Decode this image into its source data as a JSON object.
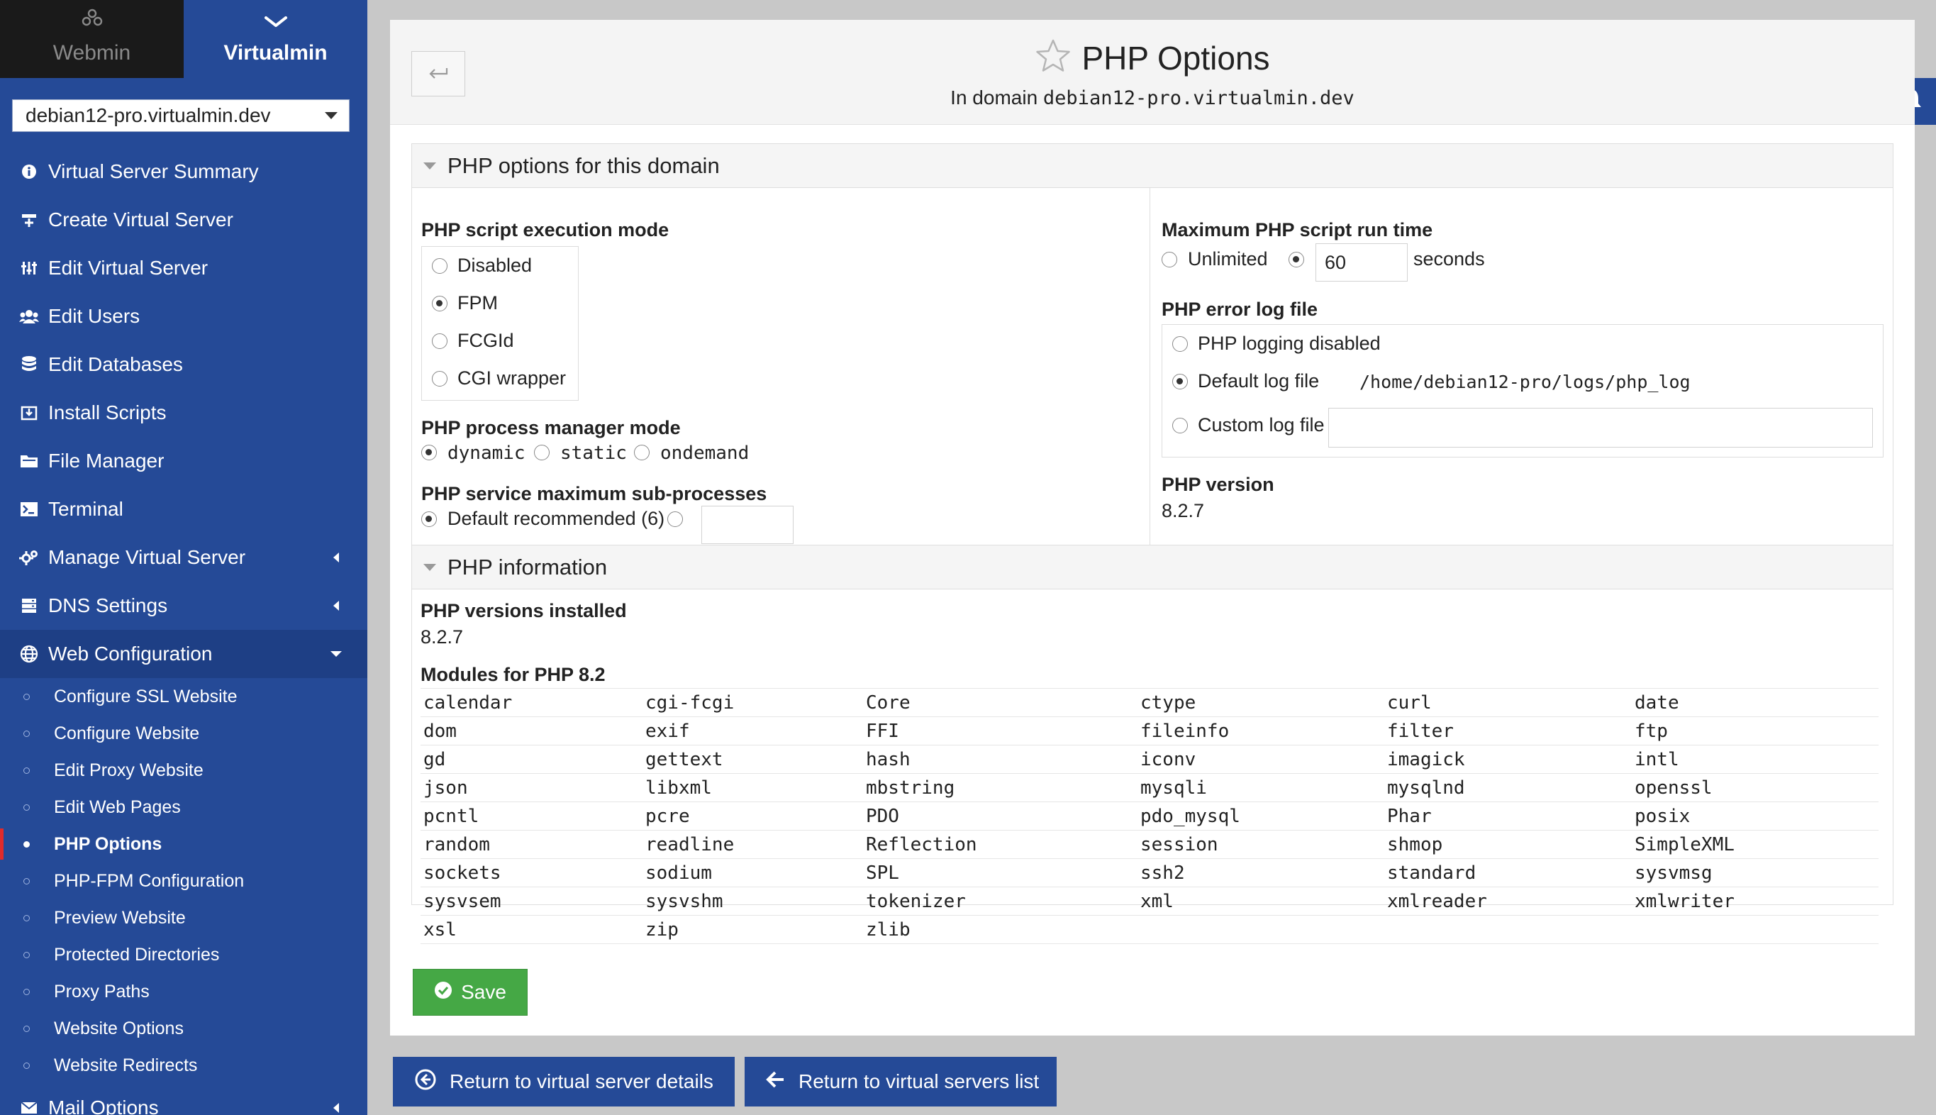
{
  "sidebar": {
    "tabs": [
      {
        "label": "Webmin",
        "icon": "webmin-logo-icon"
      },
      {
        "label": "Virtualmin",
        "icon": "chevron-down-icon"
      }
    ],
    "domain_select": "debian12-pro.virtualmin.dev",
    "menu": [
      {
        "label": "Virtual Server Summary",
        "icon": "info-icon"
      },
      {
        "label": "Create Virtual Server",
        "icon": "plus-server-icon"
      },
      {
        "label": "Edit Virtual Server",
        "icon": "sliders-icon"
      },
      {
        "label": "Edit Users",
        "icon": "users-icon"
      },
      {
        "label": "Edit Databases",
        "icon": "database-icon"
      },
      {
        "label": "Install Scripts",
        "icon": "download-icon"
      },
      {
        "label": "File Manager",
        "icon": "folder-icon"
      },
      {
        "label": "Terminal",
        "icon": "terminal-icon"
      },
      {
        "label": "Manage Virtual Server",
        "icon": "cogs-icon"
      },
      {
        "label": "DNS Settings",
        "icon": "server-icon"
      },
      {
        "label": "Web Configuration",
        "icon": "globe-icon"
      }
    ],
    "web_sub": [
      "Configure SSL Website",
      "Configure Website",
      "Edit Proxy Website",
      "Edit Web Pages",
      "PHP Options",
      "PHP-FPM Configuration",
      "Preview Website",
      "Protected Directories",
      "Proxy Paths",
      "Website Options",
      "Website Redirects"
    ],
    "mail_options": "Mail Options"
  },
  "header": {
    "title": "PHP Options",
    "subtitle_prefix": "In domain",
    "domain": "debian12-pro.virtualmin.dev"
  },
  "options_section": {
    "title": "PHP options for this domain",
    "exec_mode": {
      "label": "PHP script execution mode",
      "options": [
        "Disabled",
        "FPM",
        "FCGId",
        "CGI wrapper"
      ],
      "selected": "FPM"
    },
    "pm_mode": {
      "label": "PHP process manager mode",
      "options": [
        "dynamic",
        "static",
        "ondemand"
      ],
      "selected": "dynamic"
    },
    "max_sub": {
      "label": "PHP service maximum sub-processes",
      "default_label": "Default recommended (6)",
      "custom_value": ""
    },
    "max_runtime": {
      "label": "Maximum PHP script run time",
      "unlimited_label": "Unlimited",
      "value": "60",
      "unit": "seconds"
    },
    "error_log": {
      "label": "PHP error log file",
      "disabled_label": "PHP logging disabled",
      "default_label": "Default log file",
      "default_path": "/home/debian12-pro/logs/php_log",
      "custom_label": "Custom log file",
      "custom_value": ""
    },
    "version": {
      "label": "PHP version",
      "value": "8.2.7"
    }
  },
  "info_section": {
    "title": "PHP information",
    "installed_label": "PHP versions installed",
    "installed_value": "8.2.7",
    "modules_label": "Modules for PHP 8.2",
    "modules": [
      [
        "calendar",
        "cgi-fcgi",
        "Core",
        "ctype",
        "curl",
        "date"
      ],
      [
        "dom",
        "exif",
        "FFI",
        "fileinfo",
        "filter",
        "ftp"
      ],
      [
        "gd",
        "gettext",
        "hash",
        "iconv",
        "imagick",
        "intl"
      ],
      [
        "json",
        "libxml",
        "mbstring",
        "mysqli",
        "mysqlnd",
        "openssl"
      ],
      [
        "pcntl",
        "pcre",
        "PDO",
        "pdo_mysql",
        "Phar",
        "posix"
      ],
      [
        "random",
        "readline",
        "Reflection",
        "session",
        "shmop",
        "SimpleXML"
      ],
      [
        "sockets",
        "sodium",
        "SPL",
        "ssh2",
        "standard",
        "sysvmsg"
      ],
      [
        "sysvsem",
        "sysvshm",
        "tokenizer",
        "xml",
        "xmlreader",
        "xmlwriter"
      ],
      [
        "xsl",
        "zip",
        "zlib",
        "",
        "",
        ""
      ]
    ]
  },
  "actions": {
    "save": "Save",
    "return_details": "Return to virtual server details",
    "return_list": "Return to virtual servers list"
  },
  "colors": {
    "sidebar": "#254a97",
    "save_button": "#45a845",
    "active_marker": "#e02b2b"
  }
}
